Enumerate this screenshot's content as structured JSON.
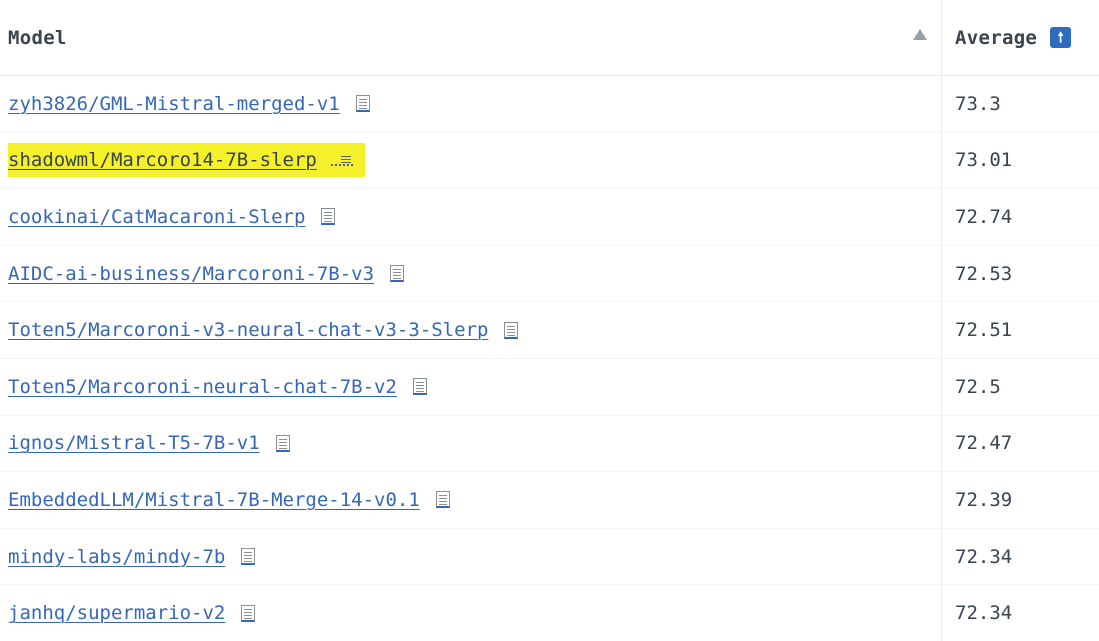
{
  "table": {
    "columns": {
      "model": "Model",
      "average": "Average"
    },
    "sort": {
      "model_indicator": "sort-ascending-icon",
      "average_button_glyph": "🠕",
      "average_button_color": "#2f6cc0"
    },
    "highlight_color": "#f4f02a",
    "link_color": "#3566b8",
    "rows": [
      {
        "model": "zyh3826/GML-Mistral-merged-v1",
        "average": "73.3",
        "highlighted": false
      },
      {
        "model": "shadowml/Marcoro14-7B-slerp",
        "average": "73.01",
        "highlighted": true
      },
      {
        "model": "cookinai/CatMacaroni-Slerp",
        "average": "72.74",
        "highlighted": false
      },
      {
        "model": "AIDC-ai-business/Marcoroni-7B-v3",
        "average": "72.53",
        "highlighted": false
      },
      {
        "model": "Toten5/Marcoroni-v3-neural-chat-v3-3-Slerp",
        "average": "72.51",
        "highlighted": false
      },
      {
        "model": "Toten5/Marcoroni-neural-chat-7B-v2",
        "average": "72.5",
        "highlighted": false
      },
      {
        "model": "ignos/Mistral-T5-7B-v1",
        "average": "72.47",
        "highlighted": false
      },
      {
        "model": "EmbeddedLLM/Mistral-7B-Merge-14-v0.1",
        "average": "72.39",
        "highlighted": false
      },
      {
        "model": "mindy-labs/mindy-7b",
        "average": "72.34",
        "highlighted": false
      },
      {
        "model": "janhq/supermario-v2",
        "average": "72.34",
        "highlighted": false
      }
    ]
  }
}
